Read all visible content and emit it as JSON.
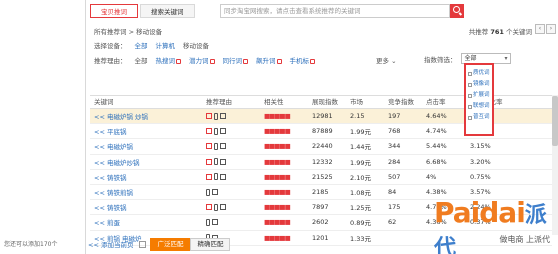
{
  "left_panel": {
    "footer_text": "您还可以添加170个"
  },
  "tabs": [
    {
      "label": "宝贝推词",
      "active": true
    },
    {
      "label": "搜索关键词",
      "active": false
    }
  ],
  "search": {
    "placeholder": "同步淘宝网搜索，请点击查看系统推荐的关键词"
  },
  "breadcrumb": "所有推荐词 > 移动设备",
  "total": {
    "prefix": "共推荐",
    "count": "761",
    "suffix": "个关键词"
  },
  "nav_buttons": [
    "‹",
    "›"
  ],
  "device_filter": {
    "label": "选择设备：",
    "options": [
      "全部",
      "计算机",
      "移动设备"
    ]
  },
  "reason_filter": {
    "label": "推荐理由：",
    "options": [
      "全部",
      "热搜词",
      "潜力词",
      "同行词",
      "飙升词",
      "手机标"
    ]
  },
  "more_label": "更多",
  "index_filter": {
    "label": "指数筛选：",
    "value": "全部"
  },
  "popup_items": [
    "质优词",
    "镜像词",
    "扩展词",
    "联想词",
    "普互词"
  ],
  "table": {
    "headers": [
      "关键词",
      "推荐理由",
      "相关性",
      "展现指数",
      "市场",
      "竞争指数",
      "点击率",
      "点击转化率"
    ],
    "rows": [
      {
        "kw": "<< 电磁炉锅 炒锅",
        "reason": [
          "hot",
          "phone",
          "pic"
        ],
        "rel": "■■■■■",
        "idx": "12981",
        "price": "2.15",
        "comp": "197",
        "ctr": "4.64%",
        "cvr": "4.50%"
      },
      {
        "kw": "<< 平底锅",
        "reason": [
          "hot",
          "phone",
          "pic"
        ],
        "rel": "■■■■■",
        "idx": "87889",
        "price": "1.99元",
        "comp": "768",
        "ctr": "4.74%",
        "cvr": "2.47%"
      },
      {
        "kw": "<< 电磁炉锅",
        "reason": [
          "hot",
          "phone",
          "pic"
        ],
        "rel": "■■■■■",
        "idx": "22440",
        "price": "1.44元",
        "comp": "344",
        "ctr": "5.44%",
        "cvr": "3.15%"
      },
      {
        "kw": "<< 电磁炉炒锅",
        "reason": [
          "hot",
          "phone",
          "pic"
        ],
        "rel": "■■■■■",
        "idx": "12332",
        "price": "1.99元",
        "comp": "284",
        "ctr": "6.68%",
        "cvr": "3.20%"
      },
      {
        "kw": "<< 铸铁锅",
        "reason": [
          "hot",
          "phone",
          "pic"
        ],
        "rel": "■■■■■",
        "idx": "21525",
        "price": "2.10元",
        "comp": "507",
        "ctr": "4%",
        "cvr": "0.75%"
      },
      {
        "kw": "<< 铸铁煎锅",
        "reason": [
          "phone",
          "pic"
        ],
        "rel": "■■■■■",
        "idx": "2185",
        "price": "1.08元",
        "comp": "84",
        "ctr": "4.38%",
        "cvr": "3.57%"
      },
      {
        "kw": "<< 铸铁锅",
        "reason": [
          "hot",
          "phone",
          "pic"
        ],
        "rel": "■■■■■",
        "idx": "7897",
        "price": "1.25元",
        "comp": "175",
        "ctr": "4.77%",
        "cvr": "2.24%"
      },
      {
        "kw": "<< 煎蛋",
        "reason": [
          "phone",
          "pic"
        ],
        "rel": "■■■■■",
        "idx": "2602",
        "price": "0.89元",
        "comp": "62",
        "ctr": "4.36%",
        "cvr": "0.37%"
      },
      {
        "kw": "<< 煎锅 电磁炉",
        "reason": [
          "phone",
          "pic"
        ],
        "rel": "■■■■■",
        "idx": "1201",
        "price": "1.33元",
        "comp": "",
        "ctr": "",
        "cvr": ""
      }
    ]
  },
  "bottom": {
    "add_page_label": "<< 添加当前页",
    "mode_on": "广泛匹配",
    "mode_off": "精确匹配"
  },
  "watermark": {
    "main": "Paidai",
    "cn": "派代",
    "sub": "做电商 上派代"
  },
  "colors": {
    "accent": "#e4393c",
    "link": "#2a6ebb",
    "orange": "#f57c00",
    "highlight_row": "#fbf1d8"
  }
}
